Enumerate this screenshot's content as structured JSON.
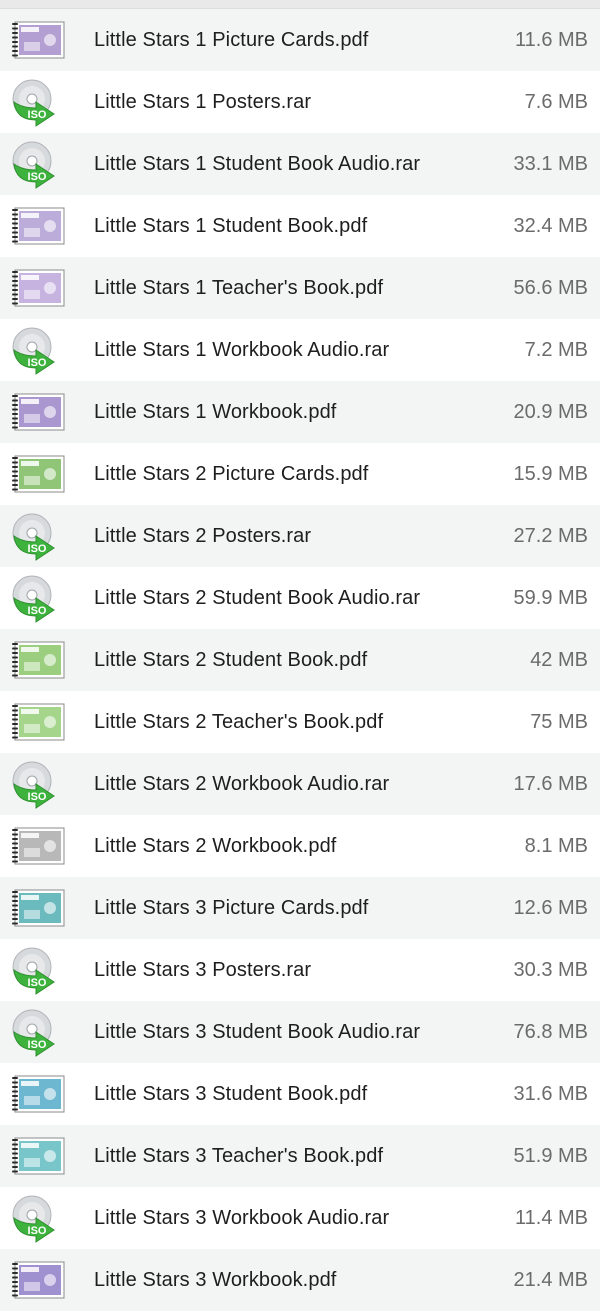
{
  "files": [
    {
      "name": "Little Stars 1 Picture Cards.pdf",
      "size": "11.6 MB",
      "icon": "pdf-book-icon",
      "tint": "#9a7fc2"
    },
    {
      "name": "Little Stars 1 Posters.rar",
      "size": "7.6 MB",
      "icon": "iso-disc-icon",
      "tint": ""
    },
    {
      "name": "Little Stars 1 Student Book Audio.rar",
      "size": "33.1 MB",
      "icon": "iso-disc-icon",
      "tint": ""
    },
    {
      "name": "Little Stars 1 Student Book.pdf",
      "size": "32.4 MB",
      "icon": "pdf-book-icon",
      "tint": "#a690cc"
    },
    {
      "name": "Little Stars 1 Teacher's Book.pdf",
      "size": "56.6 MB",
      "icon": "pdf-book-icon",
      "tint": "#b39ad6"
    },
    {
      "name": "Little Stars 1 Workbook Audio.rar",
      "size": "7.2 MB",
      "icon": "iso-disc-icon",
      "tint": ""
    },
    {
      "name": "Little Stars 1 Workbook.pdf",
      "size": "20.9 MB",
      "icon": "pdf-book-icon",
      "tint": "#8f74c0"
    },
    {
      "name": "Little Stars 2 Picture Cards.pdf",
      "size": "15.9 MB",
      "icon": "pdf-book-icon",
      "tint": "#6bb24a"
    },
    {
      "name": "Little Stars 2 Posters.rar",
      "size": "27.2 MB",
      "icon": "iso-disc-icon",
      "tint": ""
    },
    {
      "name": "Little Stars 2 Student Book Audio.rar",
      "size": "59.9 MB",
      "icon": "iso-disc-icon",
      "tint": ""
    },
    {
      "name": "Little Stars 2 Student Book.pdf",
      "size": "42 MB",
      "icon": "pdf-book-icon",
      "tint": "#79bf54"
    },
    {
      "name": "Little Stars 2 Teacher's Book.pdf",
      "size": "75 MB",
      "icon": "pdf-book-icon",
      "tint": "#86c764"
    },
    {
      "name": "Little Stars 2 Workbook Audio.rar",
      "size": "17.6 MB",
      "icon": "iso-disc-icon",
      "tint": ""
    },
    {
      "name": "Little Stars 2 Workbook.pdf",
      "size": "8.1 MB",
      "icon": "pdf-book-icon",
      "tint": "#a0a0a0"
    },
    {
      "name": "Little Stars 3 Picture Cards.pdf",
      "size": "12.6 MB",
      "icon": "pdf-book-icon",
      "tint": "#3aa3a8"
    },
    {
      "name": "Little Stars 3 Posters.rar",
      "size": "30.3 MB",
      "icon": "iso-disc-icon",
      "tint": ""
    },
    {
      "name": "Little Stars 3 Student Book Audio.rar",
      "size": "76.8 MB",
      "icon": "iso-disc-icon",
      "tint": ""
    },
    {
      "name": "Little Stars 3 Student Book.pdf",
      "size": "31.6 MB",
      "icon": "pdf-book-icon",
      "tint": "#3d9fc0"
    },
    {
      "name": "Little Stars 3 Teacher's Book.pdf",
      "size": "51.9 MB",
      "icon": "pdf-book-icon",
      "tint": "#4bb3b8"
    },
    {
      "name": "Little Stars 3 Workbook Audio.rar",
      "size": "11.4 MB",
      "icon": "iso-disc-icon",
      "tint": ""
    },
    {
      "name": "Little Stars 3 Workbook.pdf",
      "size": "21.4 MB",
      "icon": "pdf-book-icon",
      "tint": "#7f6bbf"
    }
  ],
  "colors": {
    "row_alt": "#f3f4f4",
    "row": "#ffffff",
    "iso_green": "#3db33d",
    "disc_silver": "#c9cdd1",
    "name_text": "#1e1e1e",
    "size_text": "#6b6b6b"
  }
}
